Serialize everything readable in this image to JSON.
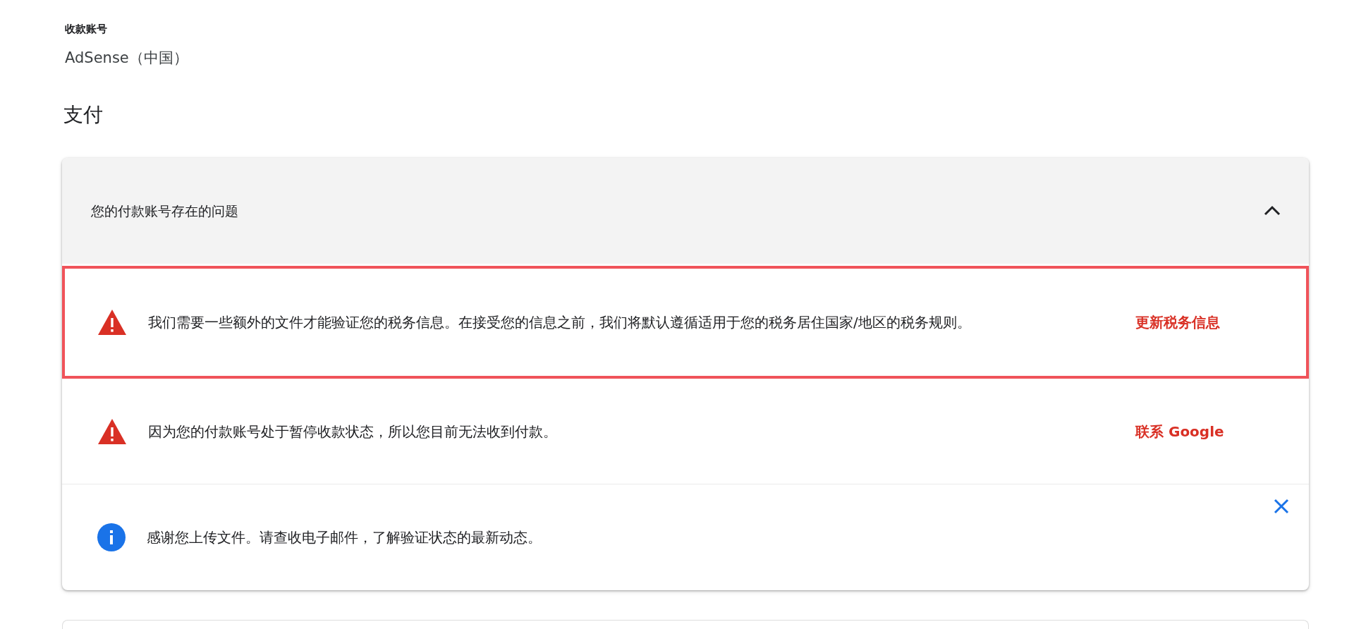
{
  "account": {
    "label": "收款账号",
    "value": "AdSense（中国）"
  },
  "section_title": "支付",
  "issues_panel": {
    "title": "您的付款账号存在的问题",
    "expanded": true,
    "alerts": [
      {
        "kind": "warning",
        "message": "我们需要一些额外的文件才能验证您的税务信息。在接受您的信息之前，我们将默认遵循适用于您的税务居住国家/地区的税务规则。",
        "action": "更新税务信息",
        "highlighted": true
      },
      {
        "kind": "warning",
        "message": "因为您的付款账号处于暂停收款状态，所以您目前无法收到付款。",
        "action": "联系 Google",
        "highlighted": false
      },
      {
        "kind": "info",
        "message": "感谢您上传文件。请查收电子邮件，了解验证状态的最新动态。",
        "dismissible": true,
        "highlighted": false
      }
    ]
  }
}
